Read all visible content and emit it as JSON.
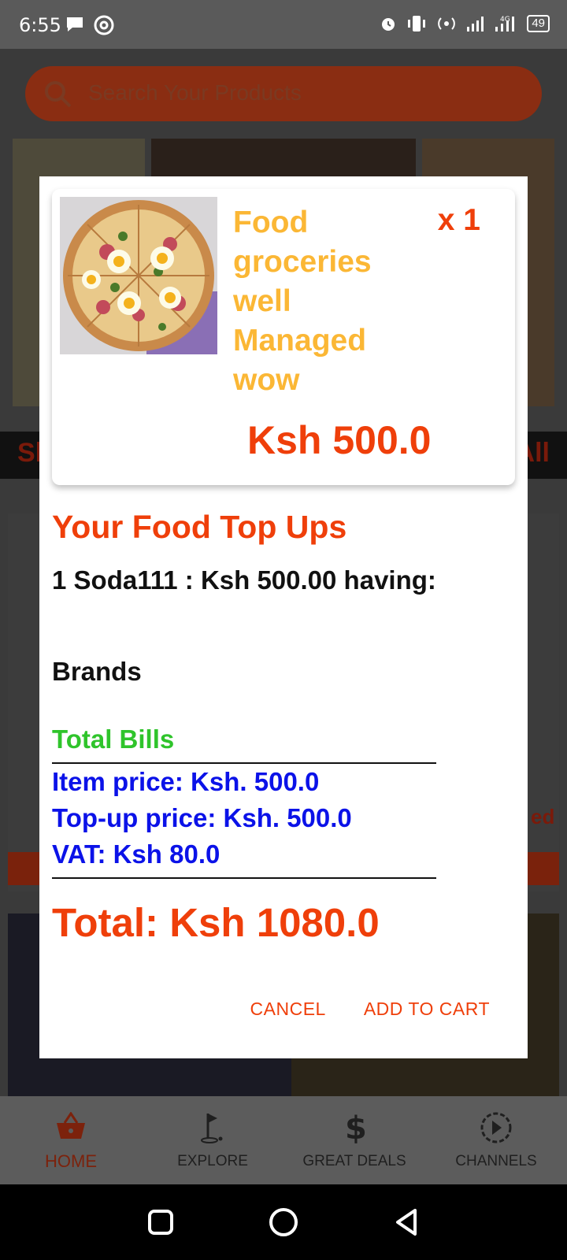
{
  "status_bar": {
    "time": "6:55",
    "battery": "49",
    "network": "4G"
  },
  "search": {
    "placeholder": "Search Your Products"
  },
  "background_band": {
    "left_text": "Sl",
    "right_text": "All"
  },
  "background_card_text": "ed",
  "dialog": {
    "product": {
      "name": "Food groceries well Managed wow",
      "quantity": "x 1",
      "price": "Ksh 500.0"
    },
    "topups_title": "Your Food Top Ups",
    "topup_line": "1 Soda111 : Ksh 500.00 having:",
    "brands_label": "Brands",
    "bills_title": "Total Bills",
    "item_price": "Item price: Ksh. 500.0",
    "topup_price": "Top-up price: Ksh. 500.0",
    "vat": "VAT: Ksh 80.0",
    "total": "Total: Ksh 1080.0",
    "cancel_label": "CANCEL",
    "add_to_cart_label": "ADD TO CART"
  },
  "bottom_nav": [
    {
      "label": "HOME",
      "icon": "basket-icon",
      "active": true
    },
    {
      "label": "EXPLORE",
      "icon": "golf-flag-icon",
      "active": false
    },
    {
      "label": "GREAT DEALS",
      "icon": "dollar-icon",
      "active": false
    },
    {
      "label": "CHANNELS",
      "icon": "play-circle-icon",
      "active": false
    }
  ],
  "colors": {
    "accent": "#ef3f0a",
    "product_name": "#fbb735",
    "bills_title": "#2fc42b",
    "bill_lines": "#0b12e8"
  }
}
